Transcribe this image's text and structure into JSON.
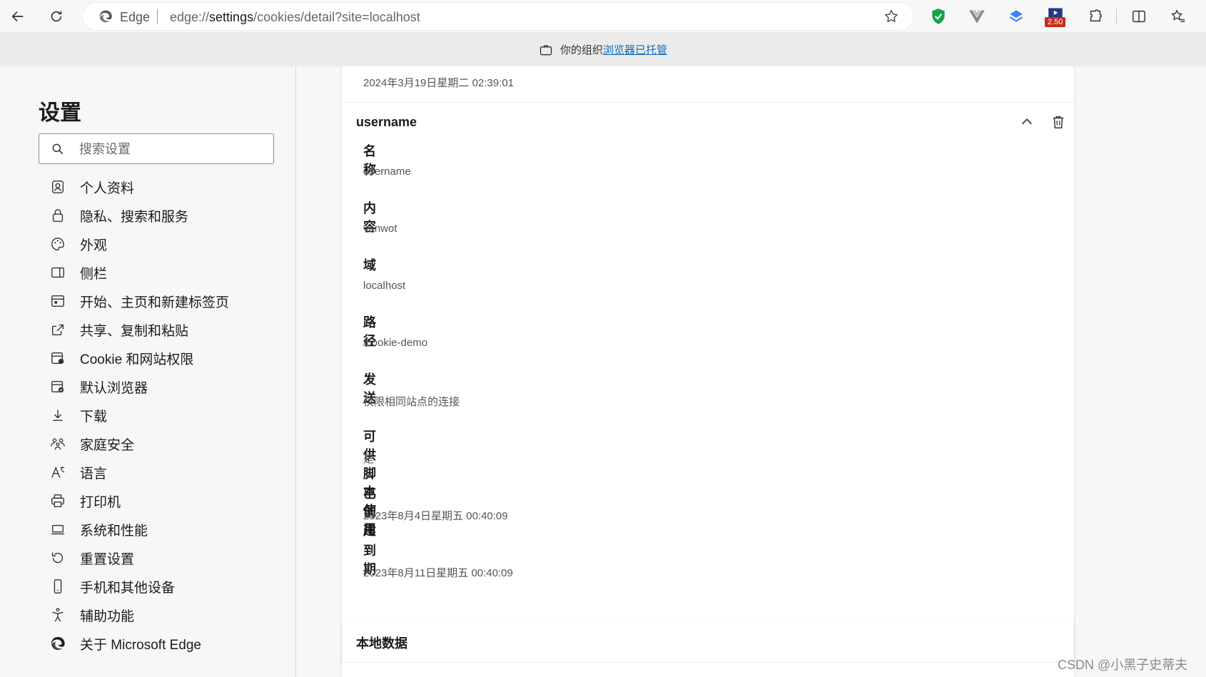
{
  "browser": {
    "address_brand": "Edge",
    "url_scheme": "edge://",
    "url_host": "settings",
    "url_path": "/cookies/detail?site=localhost",
    "extension_badge": "2.50"
  },
  "infobar": {
    "text": "你的组织",
    "link": "浏览器已托管"
  },
  "sidebar": {
    "title": "设置",
    "search_placeholder": "搜索设置",
    "items": [
      {
        "label": "个人资料",
        "icon": "profile-icon"
      },
      {
        "label": "隐私、搜索和服务",
        "icon": "lock-icon"
      },
      {
        "label": "外观",
        "icon": "palette-icon"
      },
      {
        "label": "侧栏",
        "icon": "sidebar-icon"
      },
      {
        "label": "开始、主页和新建标签页",
        "icon": "home-tab-icon"
      },
      {
        "label": "共享、复制和粘贴",
        "icon": "share-icon"
      },
      {
        "label": "Cookie 和网站权限",
        "icon": "site-permissions-icon"
      },
      {
        "label": "默认浏览器",
        "icon": "default-browser-icon"
      },
      {
        "label": "下载",
        "icon": "download-icon"
      },
      {
        "label": "家庭安全",
        "icon": "family-icon"
      },
      {
        "label": "语言",
        "icon": "language-icon"
      },
      {
        "label": "打印机",
        "icon": "printer-icon"
      },
      {
        "label": "系统和性能",
        "icon": "laptop-icon"
      },
      {
        "label": "重置设置",
        "icon": "reset-icon"
      },
      {
        "label": "手机和其他设备",
        "icon": "phone-icon"
      },
      {
        "label": "辅助功能",
        "icon": "accessibility-icon"
      },
      {
        "label": "关于 Microsoft Edge",
        "icon": "edge-logo-icon"
      }
    ]
  },
  "main": {
    "previous_expiry": "2024年3月19日星期二 02:39:01",
    "cookie": {
      "name": "username",
      "fields": [
        {
          "label": "名称",
          "value": "username"
        },
        {
          "label": "内容",
          "value": "vanwot"
        },
        {
          "label": "域",
          "value": "localhost"
        },
        {
          "label": "路径",
          "value": "/cookie-demo"
        },
        {
          "label": "发送",
          "value": "仅限相同站点的连接"
        },
        {
          "label": "可供脚本使用",
          "value": "是"
        },
        {
          "label": "已创建",
          "value": "2023年8月4日星期五 00:40:09"
        },
        {
          "label": "到期",
          "value": "2023年8月11日星期五 00:40:09"
        }
      ]
    },
    "local_data_title": "本地数据"
  },
  "watermark": "CSDN @小黑子史蒂夫",
  "colors": {
    "accent": "#0f6cbd",
    "shield_green": "#16a34a",
    "badge_red": "#c42b1c"
  }
}
